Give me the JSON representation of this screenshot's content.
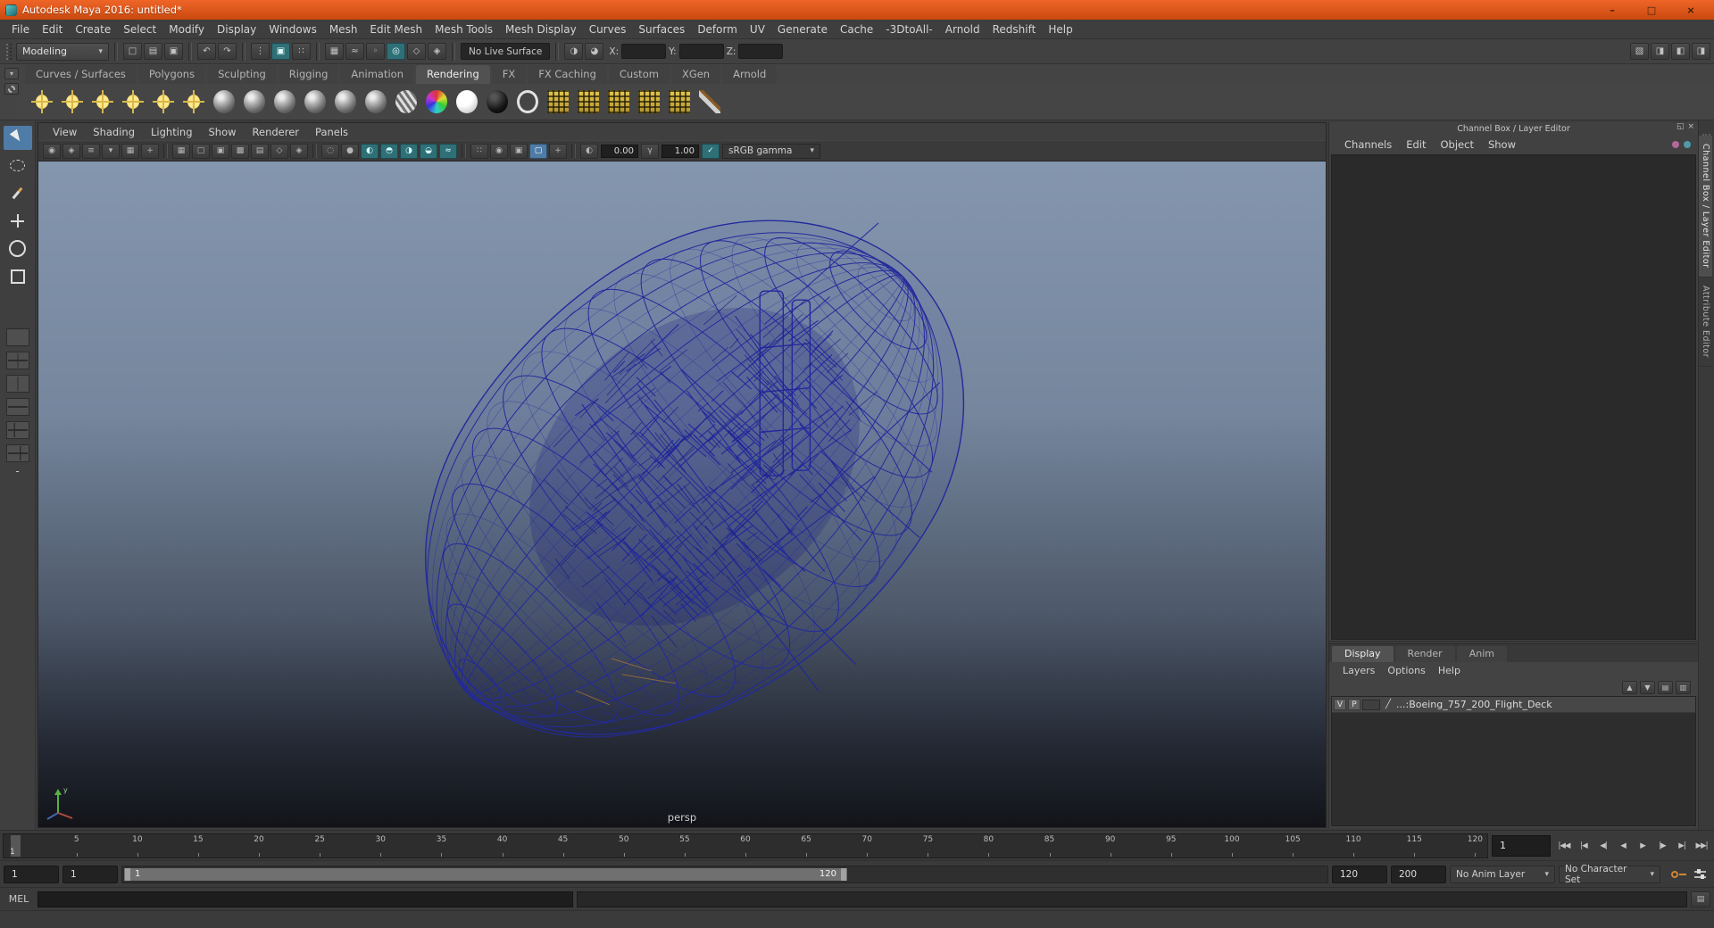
{
  "colors": {
    "titlebar_top": "#ef6528",
    "titlebar_bottom": "#c9490f",
    "highlight": "#4f7ca6",
    "teal": "#2f7077",
    "wireframe": "#232a9c",
    "viewport_top": "#8496ae",
    "viewport_bottom": "#121419"
  },
  "window": {
    "title": "Autodesk Maya 2016: untitled*",
    "minimize_glyph": "–",
    "maximize_glyph": "□",
    "close_glyph": "×"
  },
  "menubar": {
    "items": [
      "File",
      "Edit",
      "Create",
      "Select",
      "Modify",
      "Display",
      "Windows",
      "Mesh",
      "Edit Mesh",
      "Mesh Tools",
      "Mesh Display",
      "Curves",
      "Surfaces",
      "Deform",
      "UV",
      "Generate",
      "Cache",
      "-3DtoAll-",
      "Arnold",
      "Redshift",
      "Help"
    ]
  },
  "statusline": {
    "menuset": "Modeling",
    "file_icons": [
      {
        "name": "new-scene-icon",
        "glyph": "□"
      },
      {
        "name": "open-scene-icon",
        "glyph": "▤"
      },
      {
        "name": "save-scene-icon",
        "glyph": "▣"
      }
    ],
    "history_icons": [
      {
        "name": "undo-icon",
        "glyph": "↶"
      },
      {
        "name": "redo-icon",
        "glyph": "↷"
      }
    ],
    "selection_icons": [
      {
        "name": "select-hierarchy-icon",
        "glyph": "⋮"
      },
      {
        "name": "select-object-icon",
        "glyph": "▣",
        "on": true
      },
      {
        "name": "select-component-icon",
        "glyph": "∷"
      }
    ],
    "snap_icons": [
      {
        "name": "snap-to-grid-icon",
        "glyph": "▦"
      },
      {
        "name": "snap-to-curve-icon",
        "glyph": "≈"
      },
      {
        "name": "snap-to-point-icon",
        "glyph": "◦"
      },
      {
        "name": "snap-to-projected-center-icon",
        "glyph": "◎",
        "on": true
      },
      {
        "name": "snap-to-view-plane-icon",
        "glyph": "◇"
      },
      {
        "name": "make-live-icon",
        "glyph": "◈"
      }
    ],
    "live_surface": "No Live Surface",
    "misc_icons": [
      {
        "name": "symmetry-icon",
        "glyph": "◑"
      },
      {
        "name": "soft-select-icon",
        "glyph": "◕"
      }
    ],
    "coord_labels": {
      "x": "X:",
      "y": "Y:",
      "z": "Z:"
    },
    "panel_toggle_icons": [
      {
        "name": "toggle-modeling-toolkit-icon",
        "glyph": "▧"
      },
      {
        "name": "toggle-attribute-editor-icon",
        "glyph": "◨"
      },
      {
        "name": "toggle-tool-settings-icon",
        "glyph": "◧"
      },
      {
        "name": "toggle-channel-box-icon",
        "glyph": "◨"
      }
    ]
  },
  "shelf": {
    "active_tab": "Rendering",
    "tabs": [
      "Curves / Surfaces",
      "Polygons",
      "Sculpting",
      "Rigging",
      "Animation",
      "Rendering",
      "FX",
      "FX Caching",
      "Custom",
      "XGen",
      "Arnold"
    ],
    "icons": [
      {
        "name": "point-light-icon",
        "kind": "light"
      },
      {
        "name": "spot-light-icon",
        "kind": "light"
      },
      {
        "name": "area-light-icon",
        "kind": "light"
      },
      {
        "name": "directional-light-icon",
        "kind": "light"
      },
      {
        "name": "ambient-light-icon",
        "kind": "light"
      },
      {
        "name": "volume-light-icon",
        "kind": "light"
      },
      {
        "name": "material-standard-icon",
        "kind": "ball"
      },
      {
        "name": "material-blinn-icon",
        "kind": "ball"
      },
      {
        "name": "material-lambert-icon",
        "kind": "ball"
      },
      {
        "name": "material-phong-icon",
        "kind": "ball"
      },
      {
        "name": "material-phonge-icon",
        "kind": "ball"
      },
      {
        "name": "material-anisotropic-icon",
        "kind": "ball"
      },
      {
        "name": "material-ramp-icon",
        "kind": "ball-striped"
      },
      {
        "name": "color-chooser-icon",
        "kind": "ball-rgb"
      },
      {
        "name": "surface-shader-icon",
        "kind": "ball-white"
      },
      {
        "name": "use-background-icon",
        "kind": "ball-black"
      },
      {
        "name": "shading-group-icon",
        "kind": "ring"
      },
      {
        "name": "render-settings-icon",
        "kind": "grid"
      },
      {
        "name": "ipr-render-icon",
        "kind": "grid"
      },
      {
        "name": "render-current-frame-icon",
        "kind": "grid"
      },
      {
        "name": "batch-render-icon",
        "kind": "grid"
      },
      {
        "name": "hypershade-icon",
        "kind": "grid"
      },
      {
        "name": "paint-effects-icon",
        "kind": "pen"
      }
    ]
  },
  "panelbar": {
    "menus": [
      "View",
      "Shading",
      "Lighting",
      "Show",
      "Renderer",
      "Panels"
    ]
  },
  "viewport_toolbar": {
    "exposure": "0.00",
    "gamma": "1.00",
    "color_space": "sRGB gamma",
    "groups": [
      {
        "icons": [
          {
            "name": "select-camera-icon",
            "glyph": "◉"
          },
          {
            "name": "lock-camera-icon",
            "glyph": "◈"
          },
          {
            "name": "camera-attributes-icon",
            "glyph": "≡"
          },
          {
            "name": "bookmarks-icon",
            "glyph": "▾"
          },
          {
            "name": "image-plane-icon",
            "glyph": "▦"
          },
          {
            "name": "two-d-pan-zoom-icon",
            "glyph": "+"
          }
        ]
      },
      {
        "icons": [
          {
            "name": "grid-toggle-icon",
            "glyph": "▦"
          },
          {
            "name": "film-gate-icon",
            "glyph": "▢"
          },
          {
            "name": "resolution-gate-icon",
            "glyph": "▣"
          },
          {
            "name": "gate-mask-icon",
            "glyph": "▩"
          },
          {
            "name": "field-chart-icon",
            "glyph": "▤"
          },
          {
            "name": "safe-action-icon",
            "glyph": "◇"
          },
          {
            "name": "safe-title-icon",
            "glyph": "◈"
          }
        ]
      },
      {
        "icons": [
          {
            "name": "wireframe-icon",
            "glyph": "◌"
          },
          {
            "name": "smooth-shade-icon",
            "glyph": "●"
          },
          {
            "name": "textured-icon",
            "glyph": "◐",
            "on": true
          },
          {
            "name": "use-all-lights-icon",
            "glyph": "◓",
            "on": true
          },
          {
            "name": "shadows-icon",
            "glyph": "◑",
            "on": true
          },
          {
            "name": "screen-space-ao-icon",
            "glyph": "◒",
            "on": true
          },
          {
            "name": "motion-blur-icon",
            "glyph": "≈",
            "on": true
          }
        ]
      },
      {
        "icons": [
          {
            "name": "multisample-icon",
            "glyph": "∷"
          },
          {
            "name": "depth-of-field-icon",
            "glyph": "◉"
          },
          {
            "name": "isolate-select-icon",
            "glyph": "▣"
          },
          {
            "name": "xray-icon",
            "glyph": "▢",
            "hl": true
          },
          {
            "name": "joints-xray-icon",
            "glyph": "+"
          }
        ]
      }
    ]
  },
  "viewport": {
    "camera_label": "persp",
    "axis_label_y": "y"
  },
  "channel_box": {
    "header": "Channel Box / Layer Editor",
    "menus": [
      "Channels",
      "Edit",
      "Object",
      "Show"
    ]
  },
  "layer_editor": {
    "active_tab": "Display",
    "tabs": [
      "Display",
      "Render",
      "Anim"
    ],
    "menus": [
      "Layers",
      "Options",
      "Help"
    ],
    "buttons": [
      {
        "name": "move-layer-up-icon",
        "glyph": "▲"
      },
      {
        "name": "move-layer-down-icon",
        "glyph": "▼"
      },
      {
        "name": "create-empty-layer-icon",
        "glyph": "▤"
      },
      {
        "name": "create-layer-from-selected-icon",
        "glyph": "▥"
      }
    ],
    "layers": [
      {
        "visible": "V",
        "playback": "P",
        "name": "...:Boeing_757_200_Flight_Deck"
      }
    ]
  },
  "sidebar_tabs": [
    "Channel Box / Layer Editor",
    "Attribute Editor"
  ],
  "timeline": {
    "tick_labels": [
      5,
      10,
      15,
      20,
      25,
      30,
      35,
      40,
      45,
      50,
      55,
      60,
      65,
      70,
      75,
      80,
      85,
      90,
      95,
      100,
      105,
      110,
      115,
      120
    ],
    "current_frame": "1",
    "playback_buttons": [
      {
        "name": "go-to-start-button",
        "glyph": "|◀◀"
      },
      {
        "name": "step-back-frame-button",
        "glyph": "|◀"
      },
      {
        "name": "step-back-key-button",
        "glyph": "◀|"
      },
      {
        "name": "play-backwards-button",
        "glyph": "◀"
      },
      {
        "name": "play-forwards-button",
        "glyph": "▶"
      },
      {
        "name": "step-forward-key-button",
        "glyph": "|▶"
      },
      {
        "name": "step-forward-frame-button",
        "glyph": "▶|"
      },
      {
        "name": "go-to-end-button",
        "glyph": "▶▶|"
      }
    ]
  },
  "range_slider": {
    "anim_start": "1",
    "playback_start": "1",
    "bar_start_label": "1",
    "bar_end_label": "120",
    "playback_end": "120",
    "anim_end": "200",
    "anim_layer": "No Anim Layer",
    "character_set": "No Character Set"
  },
  "command_line": {
    "label": "MEL"
  }
}
